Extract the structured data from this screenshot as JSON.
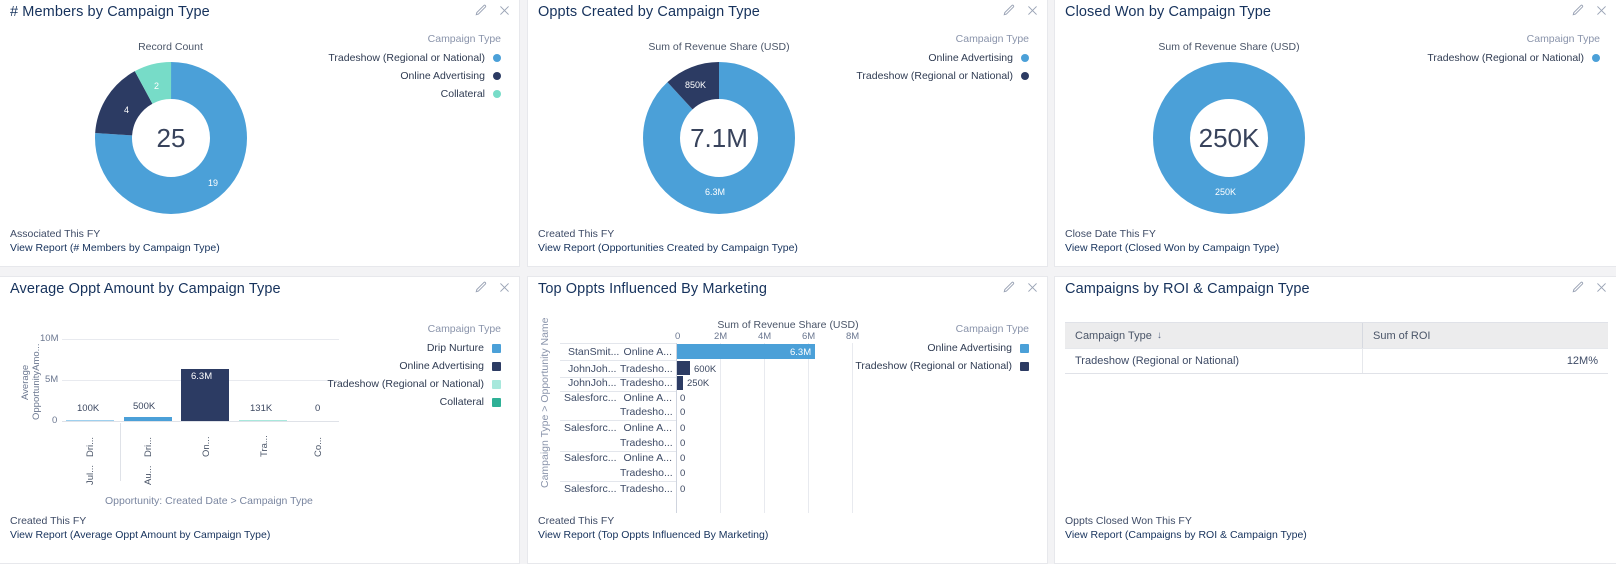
{
  "colors": {
    "blue": "#4BA0D8",
    "navy": "#2C3B63",
    "teal": "#77DCC8",
    "green": "#2EB096",
    "title": "#16325c",
    "legend_title": "#8a94ab",
    "grid": "#e8eaef"
  },
  "icons": {
    "edit": "pencil-icon",
    "close": "close-icon",
    "sort_desc": "↓"
  },
  "panels": [
    {
      "id": "members-by-campaign-type",
      "title": "# Members by Campaign Type",
      "measure_label": "Record Count",
      "center_value": "25",
      "center_unit": "",
      "legend_title": "Campaign Type",
      "footer_filter": "Associated This FY",
      "footer_link": "View Report (# Members by Campaign Type)"
    },
    {
      "id": "oppts-created-by-campaign-type",
      "title": "Oppts Created by Campaign Type",
      "measure_label": "Sum of Revenue Share (USD)",
      "center_value": "7.1",
      "center_unit": "M",
      "legend_title": "Campaign Type",
      "footer_filter": "Created This FY",
      "footer_link": "View Report (Opportunities Created by Campaign Type)"
    },
    {
      "id": "closed-won-by-campaign-type",
      "title": "Closed Won by Campaign Type",
      "measure_label": "Sum of Revenue Share (USD)",
      "center_value": "250",
      "center_unit": "K",
      "legend_title": "Campaign Type",
      "footer_filter": "Close Date This FY",
      "footer_link": "View Report (Closed Won by Campaign Type)"
    },
    {
      "id": "average-oppt-amount-by-campaign-type",
      "title": "Average Oppt Amount by Campaign Type",
      "legend_title": "Campaign Type",
      "footer_filter": "Created This FY",
      "footer_link": "View Report (Average Oppt Amount by Campaign Type)"
    },
    {
      "id": "top-oppts-influenced-by-marketing",
      "title": "Top Oppts Influenced By Marketing",
      "measure_label": "Sum of Revenue Share (USD)",
      "legend_title": "Campaign Type",
      "footer_filter": "Created This FY",
      "footer_link": "View Report (Top Oppts Influenced By Marketing)"
    },
    {
      "id": "campaigns-by-roi-campaign-type",
      "title": "Campaigns by ROI & Campaign Type",
      "footer_filter": "Oppts Closed Won This FY",
      "footer_link": "View Report (Campaigns by ROI & Campaign Type)"
    }
  ],
  "chart_data": [
    {
      "id": "members-by-campaign-type",
      "type": "pie",
      "title": "# Members by Campaign Type",
      "subtitle": "Record Count",
      "center_total": "25",
      "legend_title": "Campaign Type",
      "legend_position": "right",
      "slices": [
        {
          "label": "Tradeshow (Regional or National)",
          "value": 19,
          "display": "19",
          "color": "#4BA0D8"
        },
        {
          "label": "Online Advertising",
          "value": 4,
          "display": "4",
          "color": "#2C3B63"
        },
        {
          "label": "Collateral",
          "value": 2,
          "display": "2",
          "color": "#77DCC8"
        }
      ]
    },
    {
      "id": "oppts-created-by-campaign-type",
      "type": "pie",
      "title": "Oppts Created by Campaign Type",
      "subtitle": "Sum of Revenue Share (USD)",
      "center_total": "7.1M",
      "legend_title": "Campaign Type",
      "legend_position": "right",
      "slices": [
        {
          "label": "Online Advertising",
          "value": 6300000,
          "display": "6.3M",
          "color": "#4BA0D8"
        },
        {
          "label": "Tradeshow (Regional or National)",
          "value": 850000,
          "display": "850K",
          "color": "#2C3B63"
        }
      ]
    },
    {
      "id": "closed-won-by-campaign-type",
      "type": "pie",
      "title": "Closed Won by Campaign Type",
      "subtitle": "Sum of Revenue Share (USD)",
      "center_total": "250K",
      "legend_title": "Campaign Type",
      "legend_position": "right",
      "slices": [
        {
          "label": "Tradeshow (Regional or National)",
          "value": 250000,
          "display": "250K",
          "color": "#4BA0D8"
        }
      ]
    },
    {
      "id": "average-oppt-amount-by-campaign-type",
      "type": "bar",
      "title": "Average Oppt Amount by Campaign Type",
      "ylabel": "Average OpportunityAmo...",
      "xlabel": "Opportunity: Created Date  >  Campaign Type",
      "ylim": [
        0,
        10000000
      ],
      "yticks": [
        "0",
        "5M",
        "10M"
      ],
      "grid": true,
      "legend_title": "Campaign Type",
      "legend": [
        {
          "label": "Drip Nurture",
          "color": "#4BA0D8"
        },
        {
          "label": "Online Advertising",
          "color": "#2C3B63"
        },
        {
          "label": "Tradeshow (Regional or National)",
          "color": "#77DCC8"
        },
        {
          "label": "Collateral",
          "color": "#2EB096"
        }
      ],
      "categories": [
        "Dri...",
        "Dri...",
        "On...",
        "Tra...",
        "Co..."
      ],
      "group_labels": [
        "Jul...",
        "Au...",
        "",
        "",
        ""
      ],
      "values": [
        100000,
        500000,
        6300000,
        131000,
        0
      ],
      "value_labels": [
        "100K",
        "500K",
        "6.3M",
        "131K",
        "0"
      ],
      "bar_colors": [
        "#9ED0EE",
        "#4BA0D8",
        "#2C3B63",
        "#A8E8DC",
        "#2EB096"
      ]
    },
    {
      "id": "top-oppts-influenced-by-marketing",
      "type": "bar",
      "orientation": "horizontal",
      "title": "Top Oppts Influenced By Marketing",
      "xlabel": "Sum of Revenue Share (USD)",
      "ylabel": "Campaign Type  >  Opportunity Name",
      "xlim": [
        0,
        8800000
      ],
      "xticks": [
        "0",
        "2M",
        "4M",
        "6M",
        "8M"
      ],
      "legend_title": "Campaign Type",
      "legend": [
        {
          "label": "Online Advertising",
          "color": "#4BA0D8"
        },
        {
          "label": "Tradeshow (Regional or National)",
          "color": "#2C3B63"
        }
      ],
      "rows": [
        {
          "name": "StanSmit...",
          "type": "Online A...",
          "value": 6300000,
          "display": "6.3M",
          "color": "#4BA0D8",
          "group_start": true
        },
        {
          "name": "JohnJoh...",
          "type": "Tradesho...",
          "value": 600000,
          "display": "600K",
          "color": "#2C3B63",
          "group_start": true
        },
        {
          "name": "JohnJoh...",
          "type": "Tradesho...",
          "value": 250000,
          "display": "250K",
          "color": "#2C3B63",
          "group_start": true
        },
        {
          "name": "Salesforc...",
          "type": "Online A...",
          "value": 0,
          "display": "0",
          "color": "#4BA0D8",
          "group_start": true
        },
        {
          "name": "",
          "type": "Tradesho...",
          "value": 0,
          "display": "0",
          "color": "#2C3B63",
          "group_start": false
        },
        {
          "name": "Salesforc...",
          "type": "Online A...",
          "value": 0,
          "display": "0",
          "color": "#4BA0D8",
          "group_start": true
        },
        {
          "name": "",
          "type": "Tradesho...",
          "value": 0,
          "display": "0",
          "color": "#2C3B63",
          "group_start": false
        },
        {
          "name": "Salesforc...",
          "type": "Online A...",
          "value": 0,
          "display": "0",
          "color": "#4BA0D8",
          "group_start": true
        },
        {
          "name": "",
          "type": "Tradesho...",
          "value": 0,
          "display": "0",
          "color": "#2C3B63",
          "group_start": false
        },
        {
          "name": "Salesforc...",
          "type": "Tradesho...",
          "value": 0,
          "display": "0",
          "color": "#2C3B63",
          "group_start": true
        }
      ]
    },
    {
      "id": "campaigns-by-roi-campaign-type",
      "type": "table",
      "title": "Campaigns by ROI & Campaign Type",
      "columns": [
        "Campaign Type",
        "Sum of ROI"
      ],
      "sort_column": 0,
      "sort_direction": "desc",
      "rows": [
        [
          "Tradeshow (Regional or National)",
          "12M%"
        ]
      ]
    }
  ]
}
